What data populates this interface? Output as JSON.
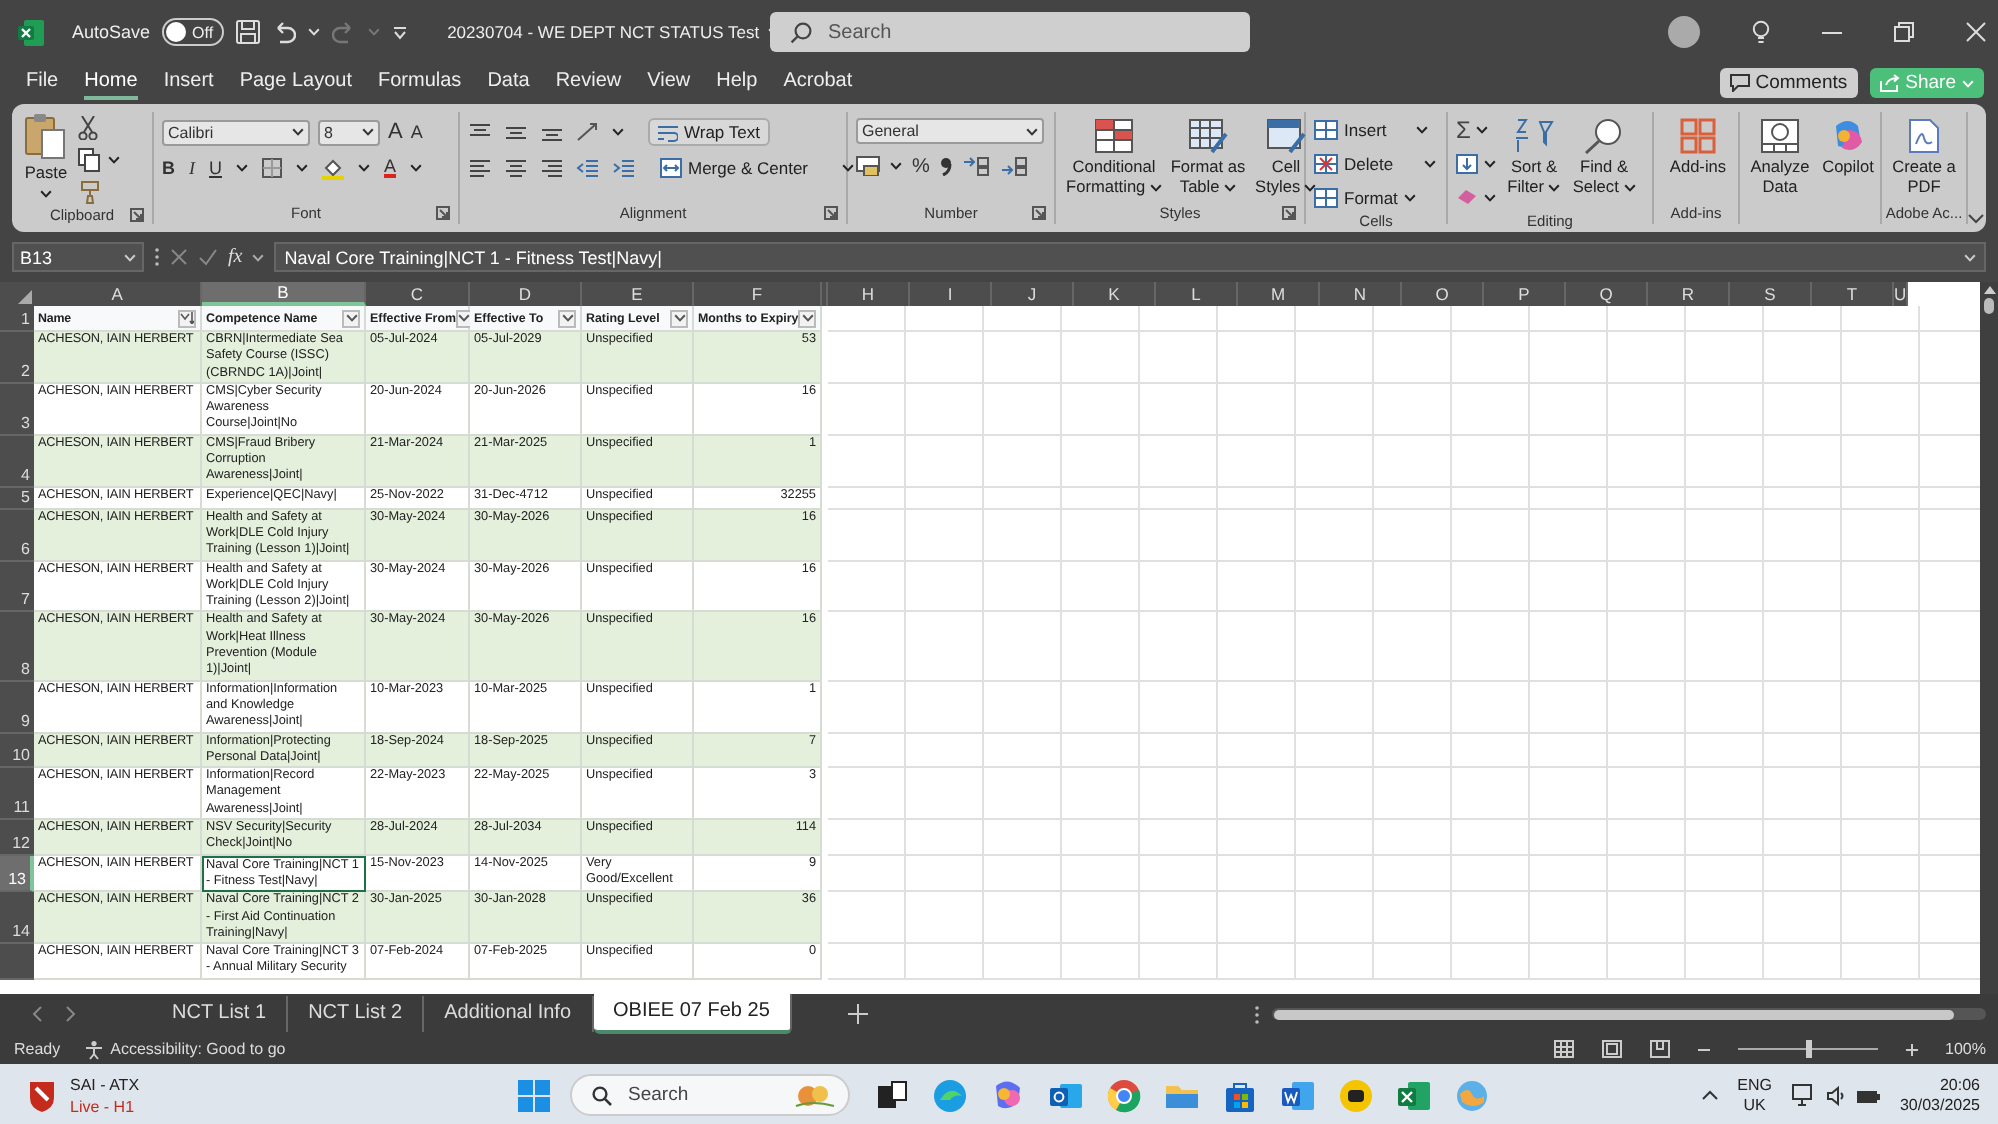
{
  "title_bar": {
    "autosave": {
      "label": "AutoSave",
      "state_text": "Off",
      "on": false
    },
    "redo_disabled": true,
    "document_title": "20230704 - WE DEPT NCT STATUS Test",
    "search_placeholder": "Search"
  },
  "menu_tabs": [
    {
      "label": "File",
      "selected": false
    },
    {
      "label": "Home",
      "selected": true
    },
    {
      "label": "Insert",
      "selected": false
    },
    {
      "label": "Page Layout",
      "selected": false
    },
    {
      "label": "Formulas",
      "selected": false
    },
    {
      "label": "Data",
      "selected": false
    },
    {
      "label": "Review",
      "selected": false
    },
    {
      "label": "View",
      "selected": false
    },
    {
      "label": "Help",
      "selected": false
    },
    {
      "label": "Acrobat",
      "selected": false
    }
  ],
  "header_buttons": {
    "comments": "Comments",
    "share": "Share"
  },
  "ribbon": {
    "clipboard": {
      "paste": "Paste",
      "label": "Clipboard"
    },
    "font": {
      "font_name": "Calibri",
      "font_size": "8",
      "grow": "A",
      "shrink": "A",
      "bold": "B",
      "italic": "I",
      "underline": "U",
      "font_color": "A",
      "label": "Font"
    },
    "alignment": {
      "wrap_text": "Wrap Text",
      "merge_center": "Merge & Center",
      "label": "Alignment"
    },
    "number": {
      "format": "General",
      "percent": "%",
      "label": "Number"
    },
    "styles": {
      "buttons": [
        "Conditional Formatting",
        "Format as Table",
        "Cell Styles"
      ],
      "label": "Styles"
    },
    "cells": {
      "buttons": [
        "Insert",
        "Delete",
        "Format"
      ],
      "label": "Cells"
    },
    "editing": {
      "autosum": "Σ",
      "buttons": [
        "Sort & Filter",
        "Find & Select"
      ],
      "label": "Editing"
    },
    "add_ins": {
      "button": "Add-ins",
      "label": "Add-ins"
    },
    "analysis": {
      "buttons": [
        "Analyze Data",
        "Copilot"
      ]
    },
    "adobe": {
      "button": "Create a PDF",
      "label": "Adobe Ac..."
    }
  },
  "formula_bar": {
    "name_box": "B13",
    "function_label": "fx",
    "formula": "Naval Core Training|NCT 1 - Fitness Test|Navy|"
  },
  "sheet": {
    "columns": [
      {
        "letter": "A",
        "selected": false
      },
      {
        "letter": "B",
        "selected": true
      },
      {
        "letter": "C",
        "selected": false
      },
      {
        "letter": "D",
        "selected": false
      },
      {
        "letter": "E",
        "selected": false
      },
      {
        "letter": "F",
        "selected": false
      },
      {
        "letter": "H",
        "selected": false
      },
      {
        "letter": "I",
        "selected": false
      },
      {
        "letter": "J",
        "selected": false
      },
      {
        "letter": "K",
        "selected": false
      },
      {
        "letter": "L",
        "selected": false
      },
      {
        "letter": "M",
        "selected": false
      },
      {
        "letter": "N",
        "selected": false
      },
      {
        "letter": "O",
        "selected": false
      },
      {
        "letter": "P",
        "selected": false
      },
      {
        "letter": "Q",
        "selected": false
      },
      {
        "letter": "R",
        "selected": false
      },
      {
        "letter": "S",
        "selected": false
      },
      {
        "letter": "T",
        "selected": false
      },
      {
        "letter": "U",
        "selected": false
      }
    ],
    "header_row": {
      "row_number": "1",
      "cells": [
        {
          "text": "Name",
          "sorted": true
        },
        {
          "text": "Competence Name",
          "sorted": false
        },
        {
          "text": "Effective From",
          "sorted": false
        },
        {
          "text": "Effective To",
          "sorted": false
        },
        {
          "text": "Rating Level",
          "sorted": false
        },
        {
          "text": "Months to Expiry",
          "sorted": false
        }
      ]
    },
    "rows": [
      {
        "row_number": "2",
        "selected": false,
        "cells": [
          "ACHESON, IAIN HERBERT",
          "CBRN|Intermediate Sea Safety Course (ISSC) (CBRNDC 1A)|Joint|",
          "05-Jul-2024",
          "05-Jul-2029",
          "Unspecified",
          "53"
        ]
      },
      {
        "row_number": "3",
        "selected": false,
        "cells": [
          "ACHESON, IAIN HERBERT",
          "CMS|Cyber Security Awareness Course|Joint|No",
          "20-Jun-2024",
          "20-Jun-2026",
          "Unspecified",
          "16"
        ]
      },
      {
        "row_number": "4",
        "selected": false,
        "cells": [
          "ACHESON, IAIN HERBERT",
          "CMS|Fraud Bribery Corruption Awareness|Joint|",
          "21-Mar-2024",
          "21-Mar-2025",
          "Unspecified",
          "1"
        ]
      },
      {
        "row_number": "5",
        "selected": false,
        "cells": [
          "ACHESON, IAIN HERBERT",
          "Experience|QEC|Navy|",
          "25-Nov-2022",
          "31-Dec-4712",
          "Unspecified",
          "32255"
        ]
      },
      {
        "row_number": "6",
        "selected": false,
        "cells": [
          "ACHESON, IAIN HERBERT",
          "Health and Safety at Work|DLE Cold Injury Training (Lesson 1)|Joint|",
          "30-May-2024",
          "30-May-2026",
          "Unspecified",
          "16"
        ]
      },
      {
        "row_number": "7",
        "selected": false,
        "cells": [
          "ACHESON, IAIN HERBERT",
          "Health and Safety at Work|DLE Cold Injury Training (Lesson 2)|Joint|",
          "30-May-2024",
          "30-May-2026",
          "Unspecified",
          "16"
        ]
      },
      {
        "row_number": "8",
        "selected": false,
        "cells": [
          "ACHESON, IAIN HERBERT",
          "Health and Safety at Work|Heat Illness Prevention (Module 1)|Joint|",
          "30-May-2024",
          "30-May-2026",
          "Unspecified",
          "16"
        ]
      },
      {
        "row_number": "9",
        "selected": false,
        "cells": [
          "ACHESON, IAIN HERBERT",
          "Information|Information and Knowledge Awareness|Joint|",
          "10-Mar-2023",
          "10-Mar-2025",
          "Unspecified",
          "1"
        ]
      },
      {
        "row_number": "10",
        "selected": false,
        "cells": [
          "ACHESON, IAIN HERBERT",
          "Information|Protecting Personal Data|Joint|",
          "18-Sep-2024",
          "18-Sep-2025",
          "Unspecified",
          "7"
        ]
      },
      {
        "row_number": "11",
        "selected": false,
        "cells": [
          "ACHESON, IAIN HERBERT",
          "Information|Record Management Awareness|Joint|",
          "22-May-2023",
          "22-May-2025",
          "Unspecified",
          "3"
        ]
      },
      {
        "row_number": "12",
        "selected": false,
        "cells": [
          "ACHESON, IAIN HERBERT",
          "NSV Security|Security Check|Joint|No",
          "28-Jul-2024",
          "28-Jul-2034",
          "Unspecified",
          "114"
        ]
      },
      {
        "row_number": "13",
        "selected": true,
        "cells": [
          "ACHESON, IAIN HERBERT",
          "Naval Core Training|NCT 1 - Fitness Test|Navy|",
          "15-Nov-2023",
          "14-Nov-2025",
          "Very Good/Excellent",
          "9"
        ]
      },
      {
        "row_number": "14",
        "selected": false,
        "cells": [
          "ACHESON, IAIN HERBERT",
          "Naval Core Training|NCT 2 - First Aid Continuation Training|Navy|",
          "30-Jan-2025",
          "30-Jan-2028",
          "Unspecified",
          "36"
        ]
      },
      {
        "selected": false,
        "cells": [
          "ACHESON, IAIN HERBERT",
          "Naval Core Training|NCT 3 - Annual Military Security",
          "07-Feb-2024",
          "07-Feb-2025",
          "Unspecified",
          "0"
        ]
      }
    ]
  },
  "sheet_tabs": [
    {
      "label": "NCT List 1",
      "selected": false
    },
    {
      "label": "NCT List 2",
      "selected": false
    },
    {
      "label": "Additional Info",
      "selected": false
    },
    {
      "label": "OBIEE 07 Feb 25",
      "selected": true
    }
  ],
  "status_bar": {
    "mode": "Ready",
    "accessibility": "Accessibility: Good to go",
    "zoom_slider": {
      "level": 0.5
    },
    "zoom": "100%"
  },
  "taskbar": {
    "widget": {
      "title": "SAI - ATX",
      "subtitle": "Live - H1"
    },
    "search_placeholder": "Search",
    "language": "ENG",
    "region": "UK",
    "time": "20:06",
    "date": "30/03/2025"
  }
}
